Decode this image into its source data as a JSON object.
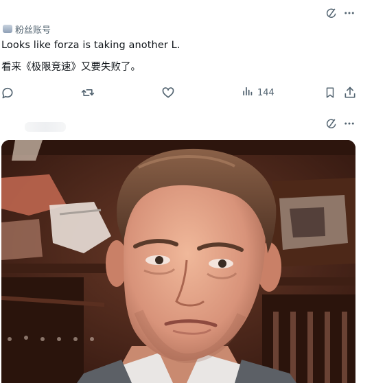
{
  "post1": {
    "author": "粉丝账号",
    "text_en": "Looks like forza is taking another L.",
    "text_zh": "看来《极限竞速》又要失败了。",
    "views": "144",
    "icons": {
      "grok": "grok-icon",
      "more": "more-icon",
      "reply": "reply-icon",
      "retweet": "retweet-icon",
      "like": "heart-icon",
      "views": "views-icon",
      "bookmark": "bookmark-icon",
      "share": "share-icon"
    }
  },
  "post2": {
    "icons": {
      "grok": "grok-icon",
      "more": "more-icon"
    },
    "media": {
      "kind": "gif-photo",
      "subject": "man-reaction-face"
    }
  },
  "colors": {
    "muted": "#536471",
    "text": "#0f1419",
    "background": "#ffffff"
  }
}
